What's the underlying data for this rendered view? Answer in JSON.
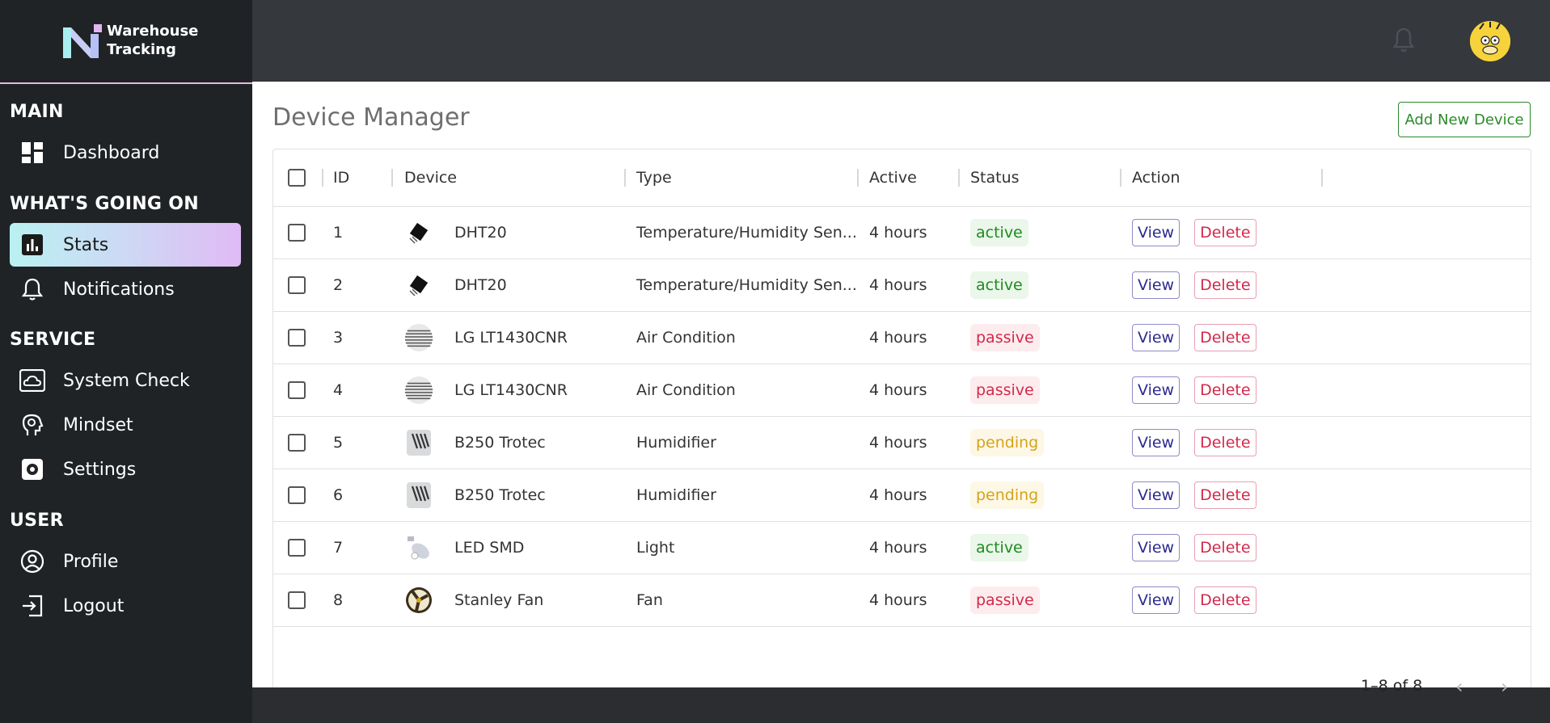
{
  "brand": {
    "line1": "Warehouse",
    "line2": "Tracking"
  },
  "sidebar": {
    "sections": {
      "main": "MAIN",
      "going_on": "WHAT'S GOING ON",
      "service": "SERVICE",
      "user": "USER"
    },
    "items": [
      {
        "label": "Dashboard",
        "icon": "dashboard-icon"
      },
      {
        "label": "Stats",
        "icon": "bar-chart-icon",
        "active": true
      },
      {
        "label": "Notifications",
        "icon": "bell-icon"
      },
      {
        "label": "System Check",
        "icon": "cloud-icon"
      },
      {
        "label": "Mindset",
        "icon": "head-gear-icon"
      },
      {
        "label": "Settings",
        "icon": "gear-icon"
      },
      {
        "label": "Profile",
        "icon": "user-circle-icon"
      },
      {
        "label": "Logout",
        "icon": "logout-icon"
      }
    ]
  },
  "page": {
    "title": "Device Manager",
    "add_button": "Add New Device"
  },
  "table": {
    "columns": [
      "ID",
      "Device",
      "Type",
      "Active",
      "Status",
      "Action"
    ],
    "rows": [
      {
        "id": "1",
        "device": "DHT20",
        "type": "Temperature/Humidity Sen...",
        "active": "4 hours",
        "status": "active",
        "thumb": "sensor-chip"
      },
      {
        "id": "2",
        "device": "DHT20",
        "type": "Temperature/Humidity Sen...",
        "active": "4 hours",
        "status": "active",
        "thumb": "sensor-chip"
      },
      {
        "id": "3",
        "device": "LG LT1430CNR",
        "type": "Air Condition",
        "active": "4 hours",
        "status": "passive",
        "thumb": "air-conditioner"
      },
      {
        "id": "4",
        "device": "LG LT1430CNR",
        "type": "Air Condition",
        "active": "4 hours",
        "status": "passive",
        "thumb": "air-conditioner"
      },
      {
        "id": "5",
        "device": "B250 Trotec",
        "type": "Humidifier",
        "active": "4 hours",
        "status": "pending",
        "thumb": "humidifier"
      },
      {
        "id": "6",
        "device": "B250 Trotec",
        "type": "Humidifier",
        "active": "4 hours",
        "status": "pending",
        "thumb": "humidifier"
      },
      {
        "id": "7",
        "device": "LED SMD",
        "type": "Light",
        "active": "4 hours",
        "status": "active",
        "thumb": "lamp"
      },
      {
        "id": "8",
        "device": "Stanley Fan",
        "type": "Fan",
        "active": "4 hours",
        "status": "passive",
        "thumb": "fan"
      }
    ],
    "view_label": "View",
    "delete_label": "Delete"
  },
  "pagination": {
    "text": "1–8 of 8",
    "prev_icon": "chevron-left-icon",
    "next_icon": "chevron-right-icon"
  },
  "colors": {
    "add_button": "#2a8a2a",
    "active": "#1f8a1f",
    "passive": "#d4284a",
    "pending": "#d6a21b",
    "view": "#2c2a8e"
  }
}
